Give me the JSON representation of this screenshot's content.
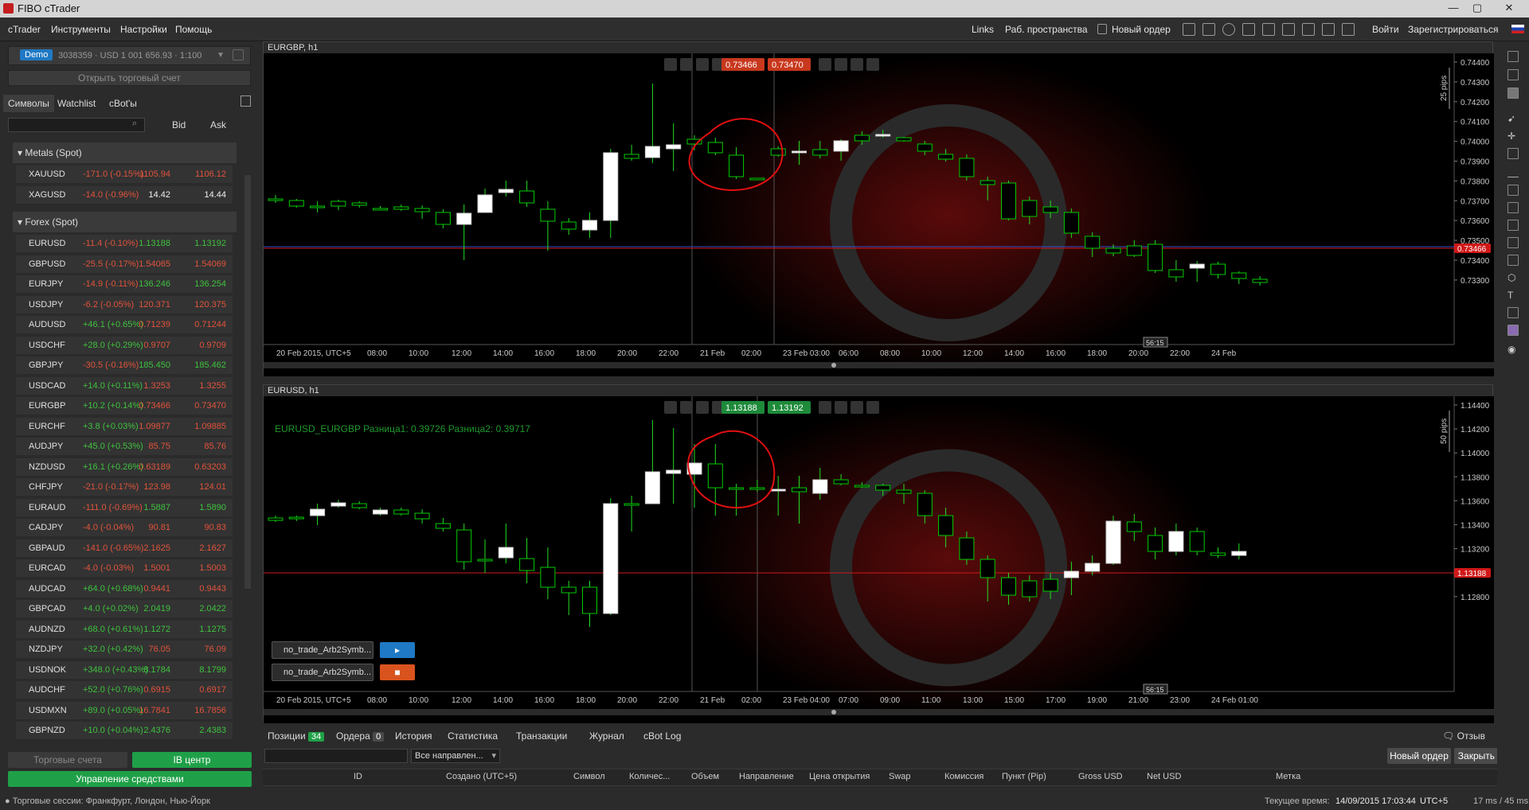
{
  "title": "FIBO cTrader",
  "menu": [
    "cTrader",
    "Инструменты",
    "Настройки",
    "Помощь"
  ],
  "topright": {
    "links": "Links",
    "workspaces": "Раб. пространства",
    "new_order": "Новый ордер",
    "login": "Войти",
    "register": "Зарегистрироваться"
  },
  "account": {
    "badge": "Demo",
    "info": "3038359 · USD 1 001 656.93 · 1:100",
    "open_account": "Открыть торговый счет"
  },
  "side_tabs": [
    "Символы",
    "Watchlist",
    "cBot'ы"
  ],
  "col_bid": "Bid",
  "col_ask": "Ask",
  "groups": {
    "metals": "Metals (Spot)",
    "forex": "Forex (Spot)"
  },
  "metals": [
    {
      "sym": "XAUUSD",
      "chg": "-171.0 (-0.15%)",
      "bid": "1105.94",
      "ask": "1106.12",
      "dir": "neg"
    },
    {
      "sym": "XAGUSD",
      "chg": "-14.0 (-0.96%)",
      "bid": "14.42",
      "ask": "14.44",
      "dir": "neu"
    }
  ],
  "forex": [
    {
      "sym": "EURUSD",
      "chg": "-11.4 (-0.10%)",
      "bid": "1.13188",
      "ask": "1.13192",
      "dir": "pos"
    },
    {
      "sym": "GBPUSD",
      "chg": "-25.5 (-0.17%)",
      "bid": "1.54065",
      "ask": "1.54069",
      "dir": "neg"
    },
    {
      "sym": "EURJPY",
      "chg": "-14.9 (-0.11%)",
      "bid": "136.246",
      "ask": "136.254",
      "dir": "pos"
    },
    {
      "sym": "USDJPY",
      "chg": "-6.2 (-0.05%)",
      "bid": "120.371",
      "ask": "120.375",
      "dir": "neg"
    },
    {
      "sym": "AUDUSD",
      "chg": "+46.1 (+0.65%)",
      "bid": "0.71239",
      "ask": "0.71244",
      "dir": "neg"
    },
    {
      "sym": "USDCHF",
      "chg": "+28.0 (+0.29%)",
      "bid": "0.9707",
      "ask": "0.9709",
      "dir": "neg"
    },
    {
      "sym": "GBPJPY",
      "chg": "-30.5 (-0.16%)",
      "bid": "185.450",
      "ask": "185.462",
      "dir": "pos"
    },
    {
      "sym": "USDCAD",
      "chg": "+14.0 (+0.11%)",
      "bid": "1.3253",
      "ask": "1.3255",
      "dir": "neg"
    },
    {
      "sym": "EURGBP",
      "chg": "+10.2 (+0.14%)",
      "bid": "0.73466",
      "ask": "0.73470",
      "dir": "neg"
    },
    {
      "sym": "EURCHF",
      "chg": "+3.8 (+0.03%)",
      "bid": "1.09877",
      "ask": "1.09885",
      "dir": "neg"
    },
    {
      "sym": "AUDJPY",
      "chg": "+45.0 (+0.53%)",
      "bid": "85.75",
      "ask": "85.76",
      "dir": "neg"
    },
    {
      "sym": "NZDUSD",
      "chg": "+16.1 (+0.26%)",
      "bid": "0.63189",
      "ask": "0.63203",
      "dir": "neg"
    },
    {
      "sym": "CHFJPY",
      "chg": "-21.0 (-0.17%)",
      "bid": "123.98",
      "ask": "124.01",
      "dir": "neg"
    },
    {
      "sym": "EURAUD",
      "chg": "-111.0 (-0.69%)",
      "bid": "1.5887",
      "ask": "1.5890",
      "dir": "pos"
    },
    {
      "sym": "CADJPY",
      "chg": "-4.0 (-0.04%)",
      "bid": "90.81",
      "ask": "90.83",
      "dir": "neg"
    },
    {
      "sym": "GBPAUD",
      "chg": "-141.0 (-0.65%)",
      "bid": "2.1625",
      "ask": "2.1627",
      "dir": "neg"
    },
    {
      "sym": "EURCAD",
      "chg": "-4.0 (-0.03%)",
      "bid": "1.5001",
      "ask": "1.5003",
      "dir": "neg"
    },
    {
      "sym": "AUDCAD",
      "chg": "+64.0 (+0.68%)",
      "bid": "0.9441",
      "ask": "0.9443",
      "dir": "neg"
    },
    {
      "sym": "GBPCAD",
      "chg": "+4.0 (+0.02%)",
      "bid": "2.0419",
      "ask": "2.0422",
      "dir": "pos"
    },
    {
      "sym": "AUDNZD",
      "chg": "+68.0 (+0.61%)",
      "bid": "1.1272",
      "ask": "1.1275",
      "dir": "pos"
    },
    {
      "sym": "NZDJPY",
      "chg": "+32.0 (+0.42%)",
      "bid": "76.05",
      "ask": "76.09",
      "dir": "neg"
    },
    {
      "sym": "USDNOK",
      "chg": "+348.0 (+0.43%)",
      "bid": "8.1784",
      "ask": "8.1799",
      "dir": "pos"
    },
    {
      "sym": "AUDCHF",
      "chg": "+52.0 (+0.76%)",
      "bid": "0.6915",
      "ask": "0.6917",
      "dir": "neg"
    },
    {
      "sym": "USDMXN",
      "chg": "+89.0 (+0.05%)",
      "bid": "16.7841",
      "ask": "16.7856",
      "dir": "neg"
    },
    {
      "sym": "GBPNZD",
      "chg": "+10.0 (+0.04%)",
      "bid": "2.4376",
      "ask": "2.4383",
      "dir": "pos"
    }
  ],
  "side_buttons": {
    "accounts": "Торговые счета",
    "ib": "IB центр",
    "funds": "Управление средствами"
  },
  "chart1": {
    "title": "EURGBP, h1",
    "bid": "0.73466",
    "ask": "0.73470",
    "price_label": "0.73466",
    "pips": "25 pips",
    "timer": "56:15",
    "yticks": [
      "0.74400",
      "0.74300",
      "0.74200",
      "0.74100",
      "0.74000",
      "0.73900",
      "0.73800",
      "0.73700",
      "0.73600",
      "0.73500",
      "0.73400",
      "0.73300"
    ],
    "xticks": [
      "20 Feb 2015, UTC+5",
      "08:00",
      "10:00",
      "12:00",
      "14:00",
      "16:00",
      "18:00",
      "20:00",
      "22:00",
      "21 Feb",
      "02:00",
      "23 Feb 03:00",
      "06:00",
      "08:00",
      "10:00",
      "12:00",
      "14:00",
      "16:00",
      "18:00",
      "20:00",
      "22:00",
      "24 Feb"
    ]
  },
  "chart2": {
    "title": "EURUSD, h1",
    "bid": "1.13188",
    "ask": "1.13192",
    "price_label": "1.13188",
    "pips": "50 pips",
    "timer": "56:15",
    "indicator": "EURUSD_EURGBP Разница1: 0.39726 Разница2: 0.39717",
    "yticks": [
      "1.14400",
      "1.14200",
      "1.14000",
      "1.13800",
      "1.13600",
      "1.13400",
      "1.13200",
      "1.13000",
      "1.12800"
    ],
    "xticks": [
      "20 Feb 2015, UTC+5",
      "08:00",
      "10:00",
      "12:00",
      "14:00",
      "16:00",
      "18:00",
      "20:00",
      "22:00",
      "21 Feb",
      "02:00",
      "23 Feb 04:00",
      "07:00",
      "09:00",
      "11:00",
      "13:00",
      "15:00",
      "17:00",
      "19:00",
      "21:00",
      "23:00",
      "24 Feb 01:00"
    ],
    "bots": [
      "no_trade_Arb2Symb...",
      "no_trade_Arb2Symb..."
    ]
  },
  "bottom": {
    "tabs": [
      {
        "label": "Позиции",
        "count": "34"
      },
      {
        "label": "Ордера",
        "count": "0"
      },
      {
        "label": "История"
      },
      {
        "label": "Статистика"
      },
      {
        "label": "Транзакции"
      },
      {
        "label": "Журнал"
      },
      {
        "label": "cBot Log"
      }
    ],
    "feedback": "Отзыв",
    "direction": "Все направлен...",
    "new_order": "Новый ордер",
    "close_all": "Закрыть все",
    "columns": [
      "ID",
      "Создано (UTC+5)",
      "Символ",
      "Количес...",
      "Объем",
      "Направление",
      "Цена открытия",
      "Swap",
      "Комиссия",
      "Пункт (Pip)",
      "Gross USD",
      "Net USD",
      "Метка"
    ]
  },
  "status": {
    "sessions": "Торговые сессии: Франкфурт, Лондон, Нью-Йорк",
    "time_label": "Текущее время:",
    "time": "14/09/2015 17:03:44",
    "tz": "UTC+5",
    "latency": "17 ms / 45 ms"
  },
  "colors": {
    "bull": "#ffffff",
    "bear": "#00cc00",
    "wick": "#22dd22",
    "bid_red": "#c8381e",
    "ask_green": "#1e8a3a",
    "price_line": "#d01818",
    "circle": "#e01010"
  }
}
